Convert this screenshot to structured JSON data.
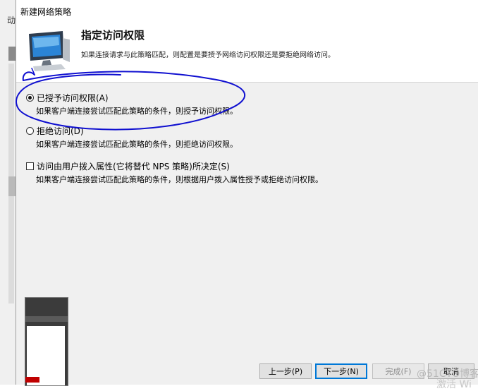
{
  "window": {
    "title": "新建网络策略",
    "bg_label": "动"
  },
  "header": {
    "title": "指定访问权限",
    "description": "如果连接请求与此策略匹配，则配置是要授予网络访问权限还是要拒绝网络访问。",
    "icon": "monitor-icon"
  },
  "options": [
    {
      "label": "已授予访问权限(A)",
      "description": "如果客户端连接尝试匹配此策略的条件，则授予访问权限。",
      "type": "radio",
      "checked": true
    },
    {
      "label": "拒绝访问(D)",
      "description": "如果客户端连接尝试匹配此策略的条件，则拒绝访问权限。",
      "type": "radio",
      "checked": false
    },
    {
      "label": "访问由用户拨入属性(它将替代 NPS 策略)所决定(S)",
      "description": "如果客户端连接尝试匹配此策略的条件，则根据用户拨入属性授予或拒绝访问权限。",
      "type": "checkbox",
      "checked": false
    }
  ],
  "buttons": {
    "previous": "上一步(P)",
    "next": "下一步(N)",
    "finish": "完成(F)",
    "cancel": "取消"
  },
  "watermark": {
    "line1": "@51CTO博客",
    "line2": "激活 Wi"
  },
  "colors": {
    "annotation": "#1010d0",
    "focus": "#0078d7"
  }
}
